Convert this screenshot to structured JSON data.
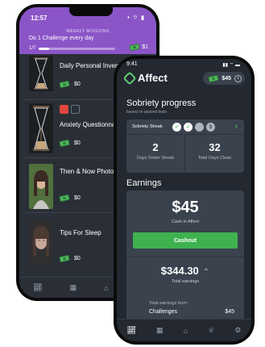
{
  "back": {
    "status": {
      "time": "12:57",
      "signal": "• ⌔ ▮"
    },
    "weekly": {
      "tag": "WEEKLY MISSIONS",
      "title": "Do 1 Challenge every day",
      "count": "1/7",
      "progress": 0.14,
      "reward": "$1"
    },
    "items": [
      {
        "title": "Daily Personal Inventory",
        "amount": "$0"
      },
      {
        "title": "Anxiety Questionnaire",
        "amount": "$0"
      },
      {
        "title": "Then & Now Photographs",
        "amount": "$0"
      },
      {
        "title": "Tips For Sleep",
        "amount": "$0"
      }
    ],
    "tabs": [
      "chart-icon",
      "calendar-icon",
      "home-icon",
      "trophy-icon"
    ]
  },
  "front": {
    "status": {
      "time": "9:41",
      "signal": "▮▮ ⌔ ▬"
    },
    "app_name": "Affect",
    "balance": "$45",
    "sobriety": {
      "title": "Sobriety progress",
      "subtitle": "based on passed tests",
      "streak_label": "Sobriety Streak",
      "streak_dots": [
        "✓",
        "✓",
        "",
        "$"
      ],
      "days_sober_streak": "2",
      "days_sober_streak_label": "Days Sober Streak",
      "total_days_clean": "32",
      "total_days_clean_label": "Total Days Clean"
    },
    "earnings": {
      "title": "Earnings",
      "cash_amount": "$45",
      "cash_label": "Cash in Affect",
      "cashout_label": "Cashout",
      "total_amount": "$344.30",
      "total_label": "Total earnings",
      "from_label": "Total earnings from:",
      "from_items": [
        {
          "name": "Challenges",
          "amount": "$45"
        }
      ]
    },
    "tabs": [
      "chart-icon",
      "calendar-icon",
      "home-icon",
      "trophy-icon",
      "settings-icon"
    ]
  },
  "colors": {
    "accent_green": "#3fb24f",
    "mission_purple": "#8b55c7",
    "card_bg": "#3a424e"
  }
}
